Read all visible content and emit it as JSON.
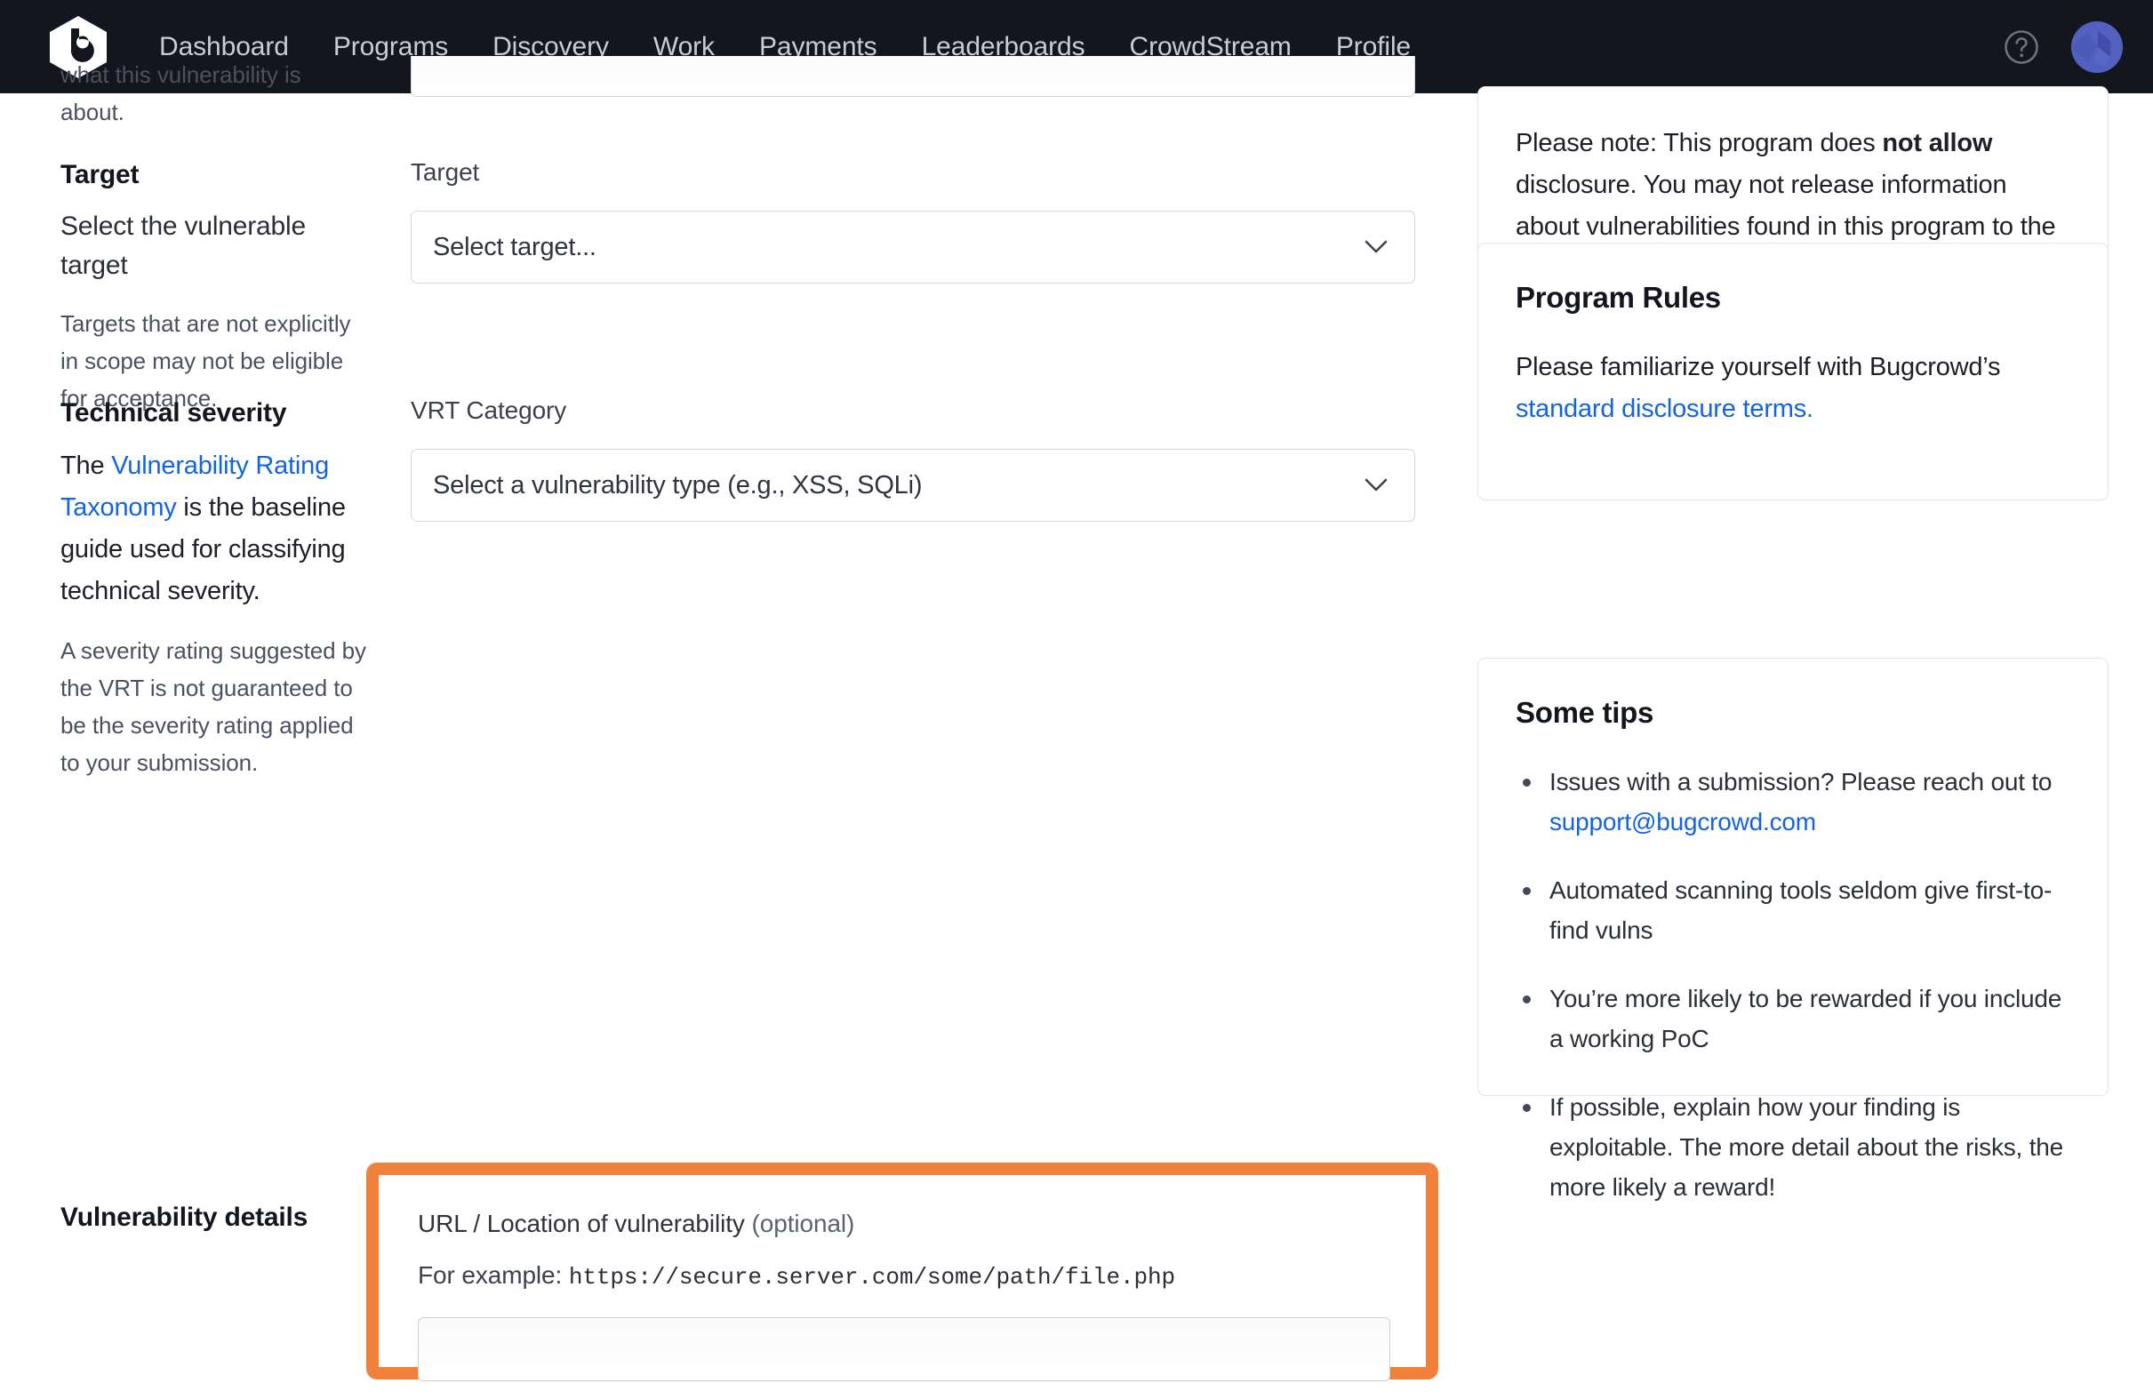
{
  "header": {
    "logo_alt": "Bugcrowd",
    "nav": [
      {
        "label": "Dashboard"
      },
      {
        "label": "Programs"
      },
      {
        "label": "Discovery"
      },
      {
        "label": "Work"
      },
      {
        "label": "Payments"
      },
      {
        "label": "Leaderboards"
      },
      {
        "label": "CrowdStream"
      },
      {
        "label": "Profile"
      }
    ],
    "help_icon": "question-circle-icon",
    "avatar_icon": "user-avatar"
  },
  "form": {
    "description_tail": "what this vulnerability is about.",
    "target": {
      "title": "Target",
      "subtitle": "Select the vulnerable target",
      "help": "Targets that are not explicitly in scope may not be eligible for acceptance.",
      "field_label": "Target",
      "select_value": "Select target...",
      "chevron": "chevron-down-icon"
    },
    "severity": {
      "title": "Technical severity",
      "body_pre": "The ",
      "body_link": "Vulnerability Rating Taxonomy",
      "body_post": " is the baseline guide used for classifying technical severity.",
      "help": "A severity rating suggested by the VRT is not guaranteed to be the severity rating applied to your submission.",
      "field_label": "VRT Category",
      "select_value": "Select a vulnerability type (e.g., XSS, SQLi)",
      "chevron": "chevron-down-icon"
    },
    "details": {
      "title": "Vulnerability details",
      "url_label": "URL / Location of vulnerability",
      "url_optional": "(optional)",
      "example_prefix": "For example: ",
      "example_url": "https://secure.server.com/some/path/file.php",
      "url_input_value": "",
      "url_input_placeholder": "",
      "highlight_color": "#f0813c"
    }
  },
  "rail": {
    "disclosure": {
      "text_pre": "Please note: This program does ",
      "text_bold": "not allow",
      "text_post": " disclosure. You may not release information about vulnerabilities found in this program to the public."
    },
    "program_rules": {
      "title": "Program Rules",
      "text_pre": "Please familiarize yourself with Bugcrowd’s ",
      "link": "standard disclosure terms."
    },
    "tips": {
      "title": "Some tips",
      "items": [
        {
          "pre": "Issues with a submission? Please reach out to ",
          "link": "support@bugcrowd.com",
          "post": ""
        },
        {
          "pre": "Automated scanning tools seldom give first-to-find vulns",
          "link": "",
          "post": ""
        },
        {
          "pre": "You’re more likely to be rewarded if you include a working PoC",
          "link": "",
          "post": ""
        },
        {
          "pre": "If possible, explain how your finding is exploitable. The more detail about the risks, the more likely a reward!",
          "link": "",
          "post": ""
        }
      ]
    }
  },
  "colors": {
    "nav_bg": "#14161d",
    "link_blue": "#1464de",
    "highlight_orange": "#f0813c"
  }
}
